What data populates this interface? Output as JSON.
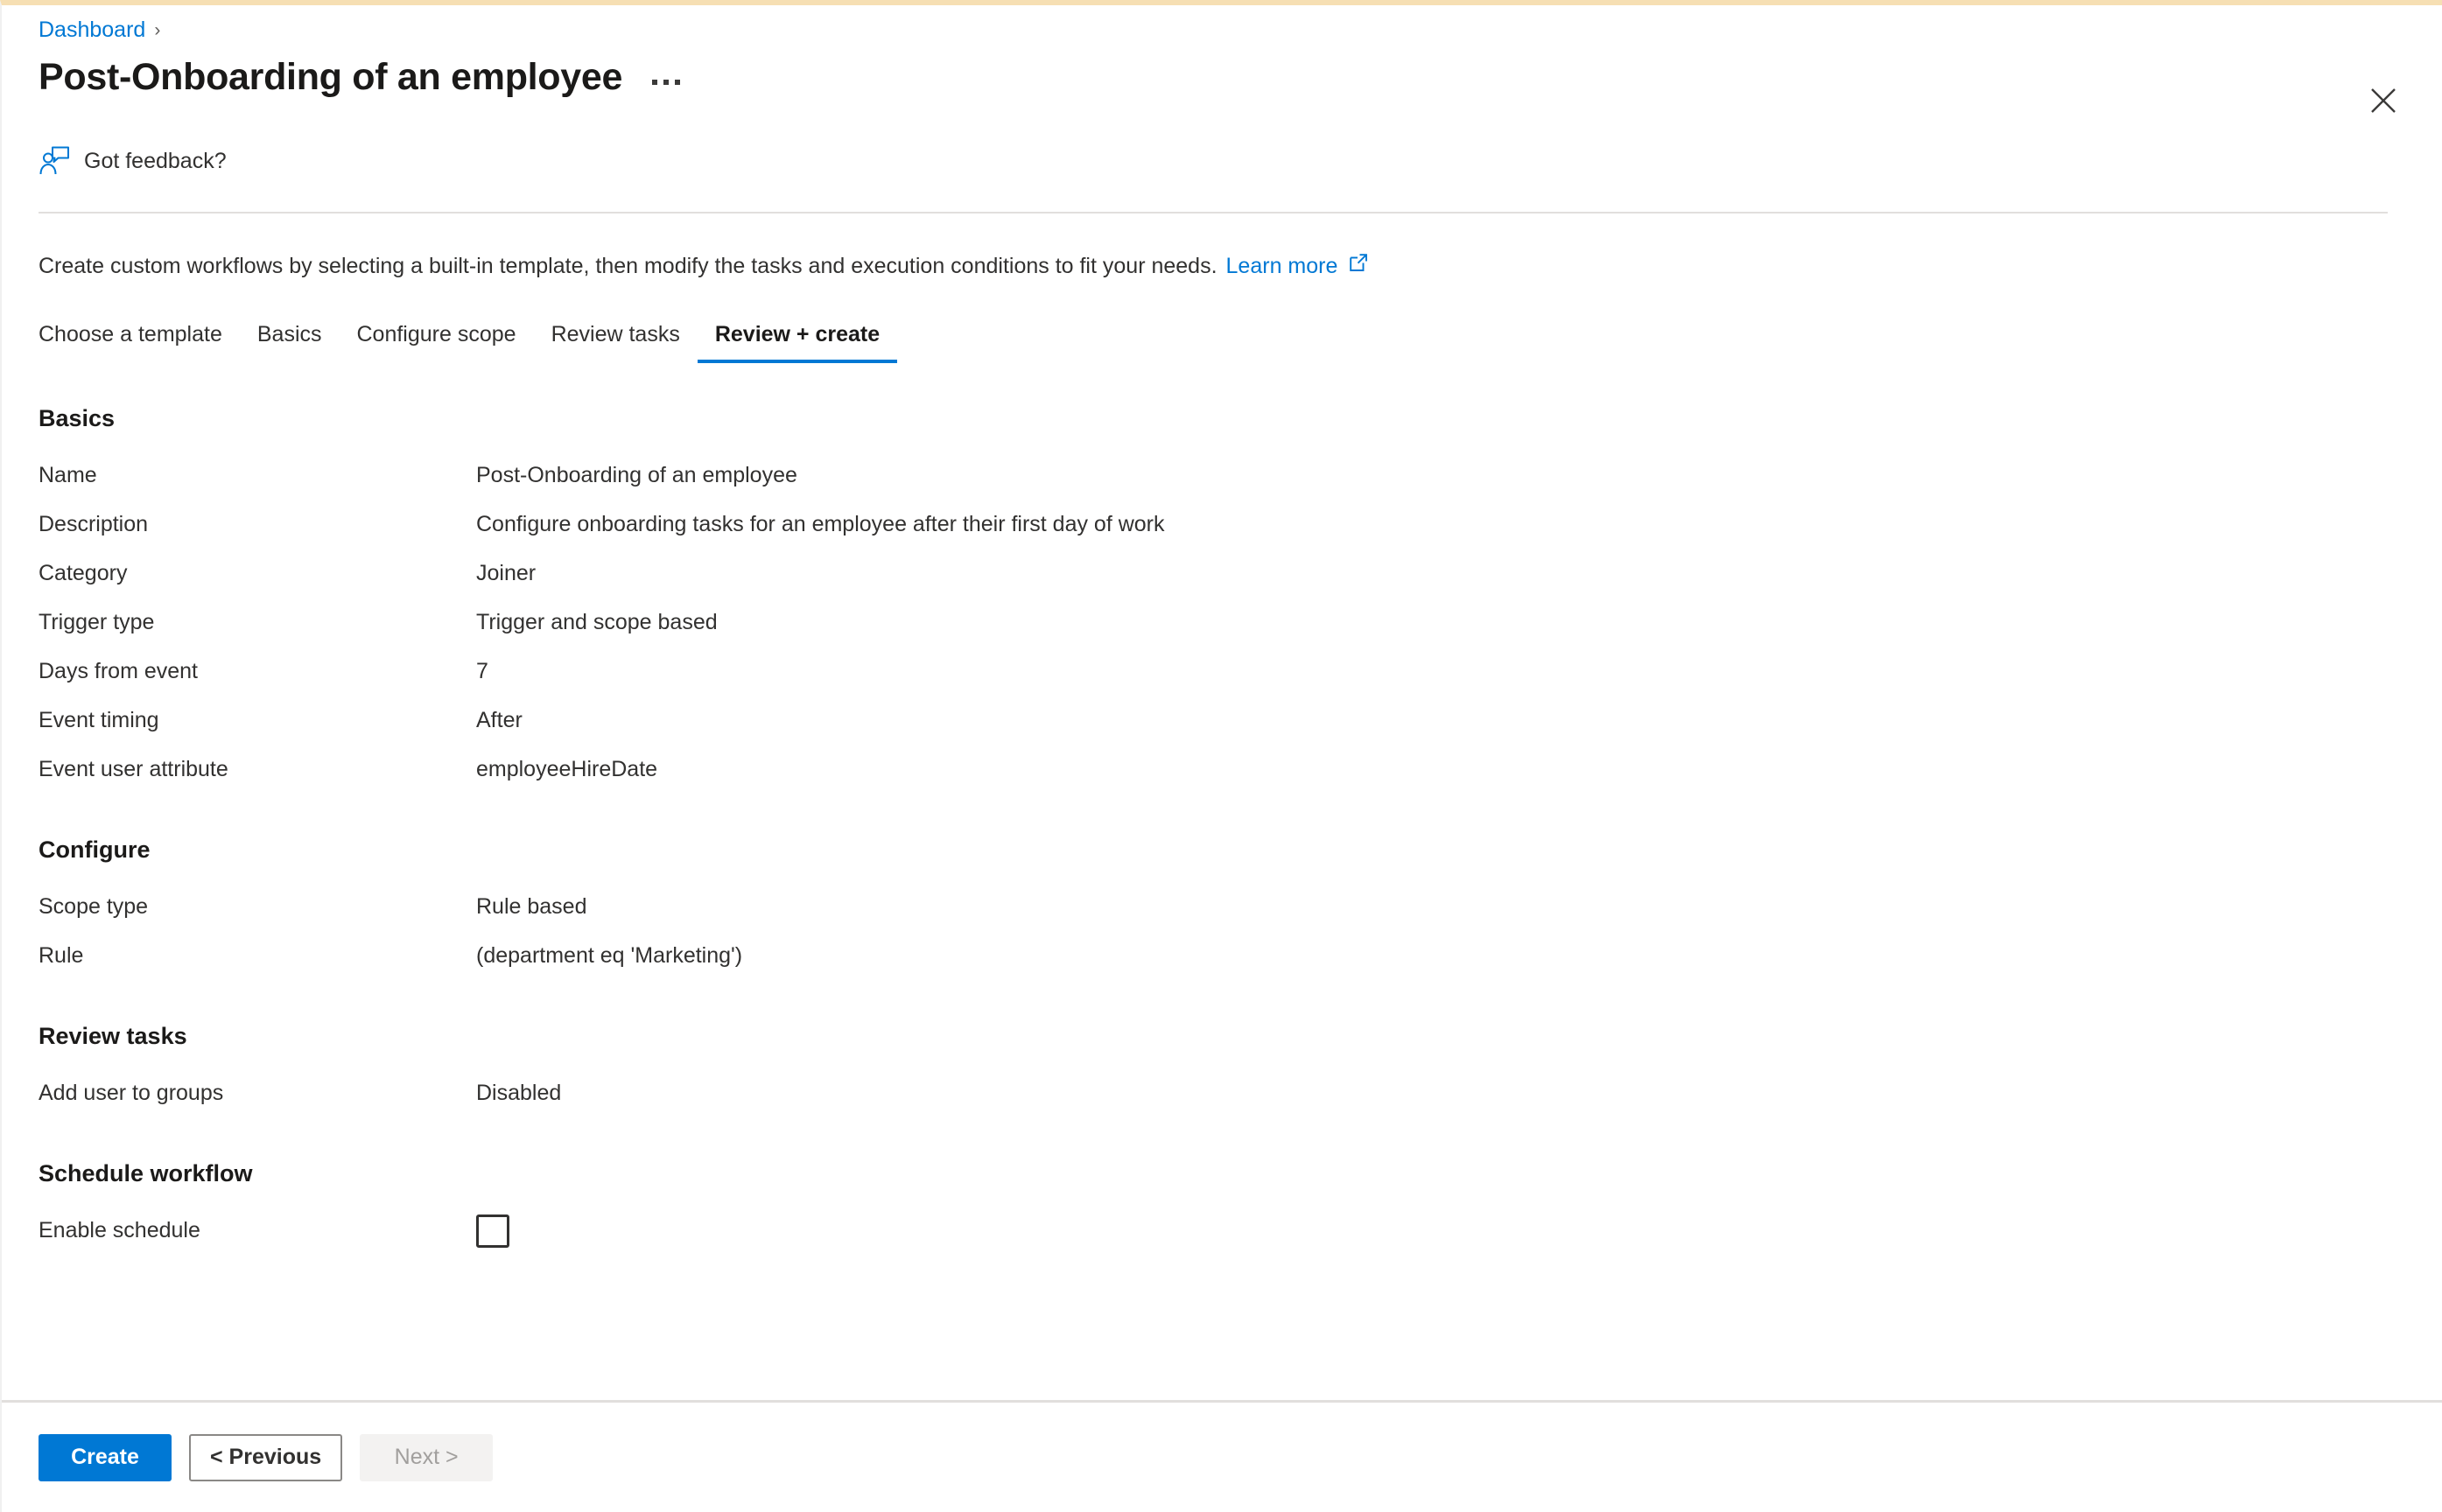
{
  "breadcrumb": {
    "items": [
      "Dashboard"
    ],
    "separator": "›"
  },
  "header": {
    "title": "Post-Onboarding of an employee",
    "more_menu_icon": "ellipsis-icon",
    "close_icon": "close-icon"
  },
  "feedback": {
    "label": "Got feedback?",
    "icon": "person-feedback-icon"
  },
  "intro": {
    "text": "Create custom workflows by selecting a built-in template, then modify the tasks and execution conditions to fit your needs.",
    "link_label": "Learn more",
    "link_icon": "external-link-icon"
  },
  "tabs": [
    {
      "label": "Choose a template",
      "active": false
    },
    {
      "label": "Basics",
      "active": false
    },
    {
      "label": "Configure scope",
      "active": false
    },
    {
      "label": "Review tasks",
      "active": false
    },
    {
      "label": "Review + create",
      "active": true
    }
  ],
  "sections": [
    {
      "heading": "Basics",
      "rows": [
        {
          "key": "Name",
          "value": "Post-Onboarding of an employee"
        },
        {
          "key": "Description",
          "value": "Configure onboarding tasks for an employee after their first day of work"
        },
        {
          "key": "Category",
          "value": "Joiner"
        },
        {
          "key": "Trigger type",
          "value": "Trigger and scope based"
        },
        {
          "key": "Days from event",
          "value": "7"
        },
        {
          "key": "Event timing",
          "value": "After"
        },
        {
          "key": "Event user attribute",
          "value": "employeeHireDate"
        }
      ]
    },
    {
      "heading": "Configure",
      "rows": [
        {
          "key": "Scope type",
          "value": "Rule based"
        },
        {
          "key": "Rule",
          "value": "(department eq 'Marketing')"
        }
      ]
    },
    {
      "heading": "Review tasks",
      "rows": [
        {
          "key": "Add user to groups",
          "value": "Disabled"
        }
      ]
    },
    {
      "heading": "Schedule workflow",
      "rows": [
        {
          "key": "Enable schedule",
          "value": "",
          "control": "checkbox",
          "checked": false
        }
      ]
    }
  ],
  "footer": {
    "create_label": "Create",
    "previous_label": "< Previous",
    "next_label": "Next >",
    "next_disabled": true
  },
  "colors": {
    "accent": "#0078d4",
    "text": "#323130",
    "heading": "#1b1a19",
    "divider": "#e1dfdd",
    "disabled_text": "#a19f9d",
    "top_accent": "#f6dfb3"
  }
}
